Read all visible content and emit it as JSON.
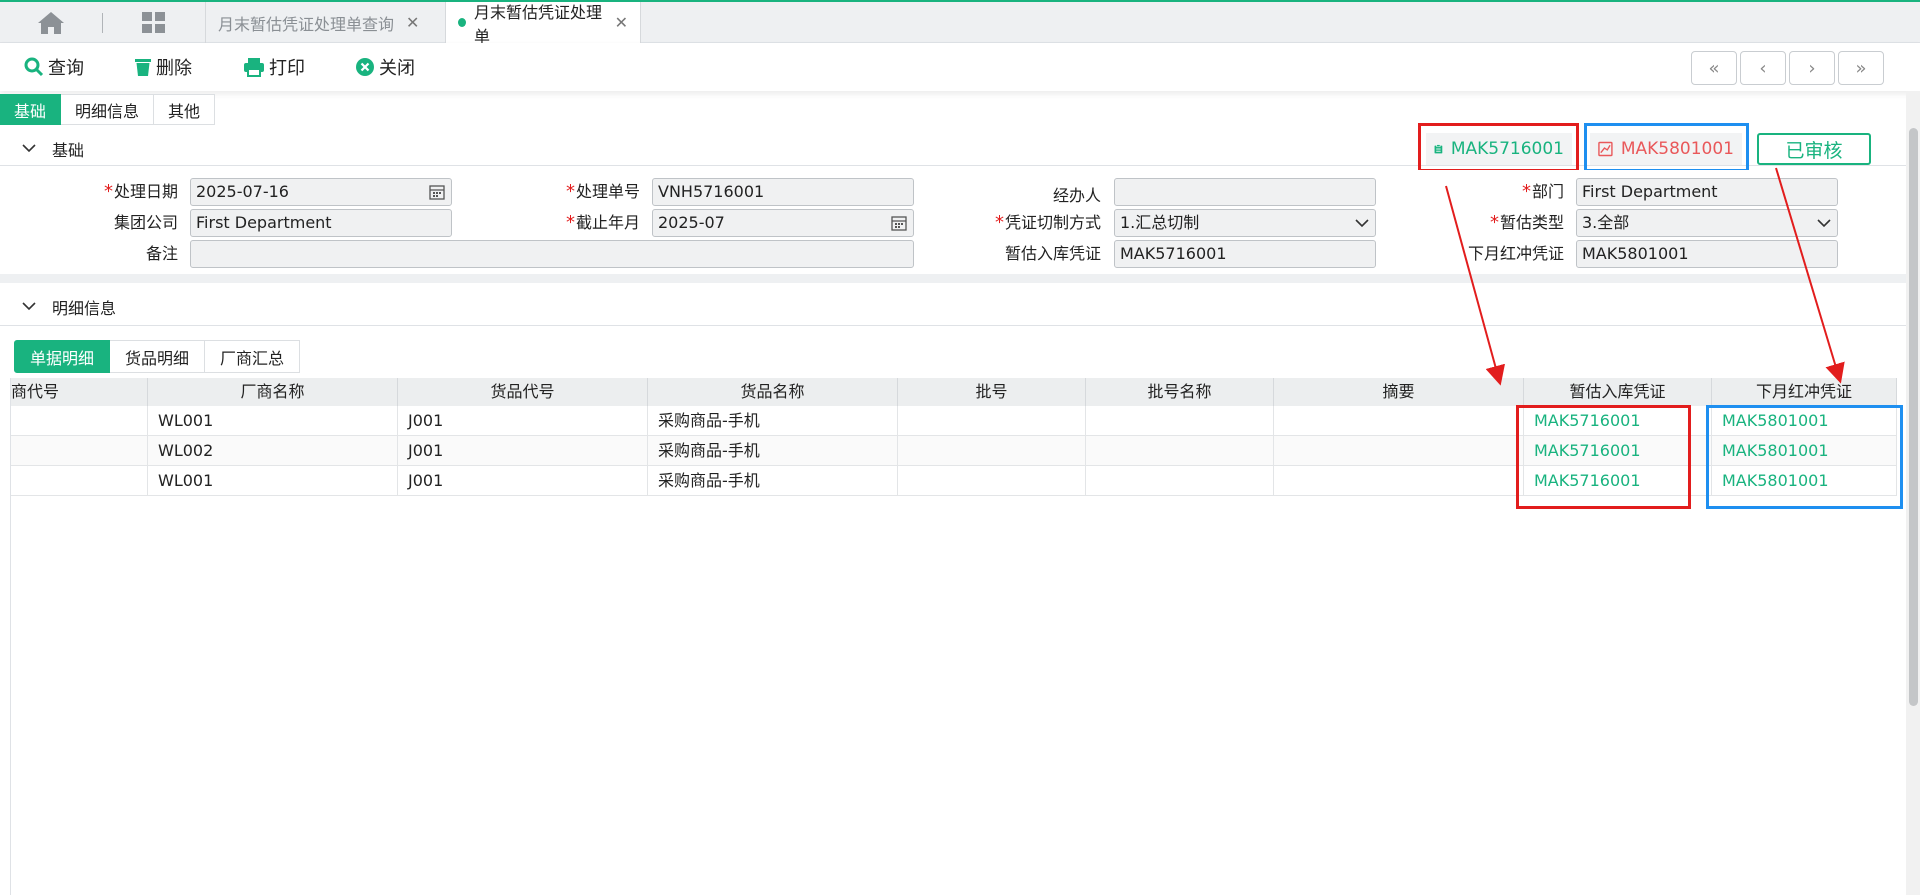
{
  "tabs": [
    {
      "label": "月末暂估凭证处理单查询"
    },
    {
      "label": "月末暂估凭证处理单"
    }
  ],
  "toolbar": {
    "query": "查询",
    "delete": "删除",
    "print": "打印",
    "close": "关闭",
    "nav": [
      "«",
      "‹",
      "›",
      "»"
    ]
  },
  "subtabs": [
    "基础",
    "明细信息",
    "其他"
  ],
  "section_basic": "基础",
  "section_detail": "明细信息",
  "voucher_in": "MAK5716001",
  "voucher_red": "MAK5801001",
  "status": "已审核",
  "form": {
    "process_date_label": "处理日期",
    "process_date": "2025-07-16",
    "process_no_label": "处理单号",
    "process_no": "VNH5716001",
    "handler_label": "经办人",
    "handler": "",
    "dept_label": "部门",
    "dept": "First Department",
    "group_label": "集团公司",
    "group": "First Department",
    "cutoff_label": "截止年月",
    "cutoff": "2025-07",
    "split_label": "凭证切制方式",
    "split": "1.汇总切制",
    "est_type_label": "暂估类型",
    "est_type": "3.全部",
    "remark_label": "备注",
    "remark": "",
    "in_voucher_label": "暂估入库凭证",
    "in_voucher": "MAK5716001",
    "red_voucher_label": "下月红冲凭证",
    "red_voucher": "MAK5801001"
  },
  "detail_tabs": [
    "单据明细",
    "货品明细",
    "厂商汇总"
  ],
  "grid": {
    "columns": [
      "商代号",
      "厂商名称",
      "货品代号",
      "货品名称",
      "批号",
      "批号名称",
      "摘要",
      "暂估入库凭证",
      "下月红冲凭证"
    ],
    "rows": [
      [
        "",
        "WL001",
        "J001",
        "采购商品-手机",
        "",
        "",
        "",
        "MAK5716001",
        "MAK5801001"
      ],
      [
        "",
        "WL002",
        "J001",
        "采购商品-手机",
        "",
        "",
        "",
        "MAK5716001",
        "MAK5801001"
      ],
      [
        "",
        "WL001",
        "J001",
        "采购商品-手机",
        "",
        "",
        "",
        "MAK5716001",
        "MAK5801001"
      ]
    ]
  },
  "colors": {
    "accent": "#19b37f",
    "red_highlight": "#e21d1d",
    "blue_highlight": "#1e8ff0"
  }
}
